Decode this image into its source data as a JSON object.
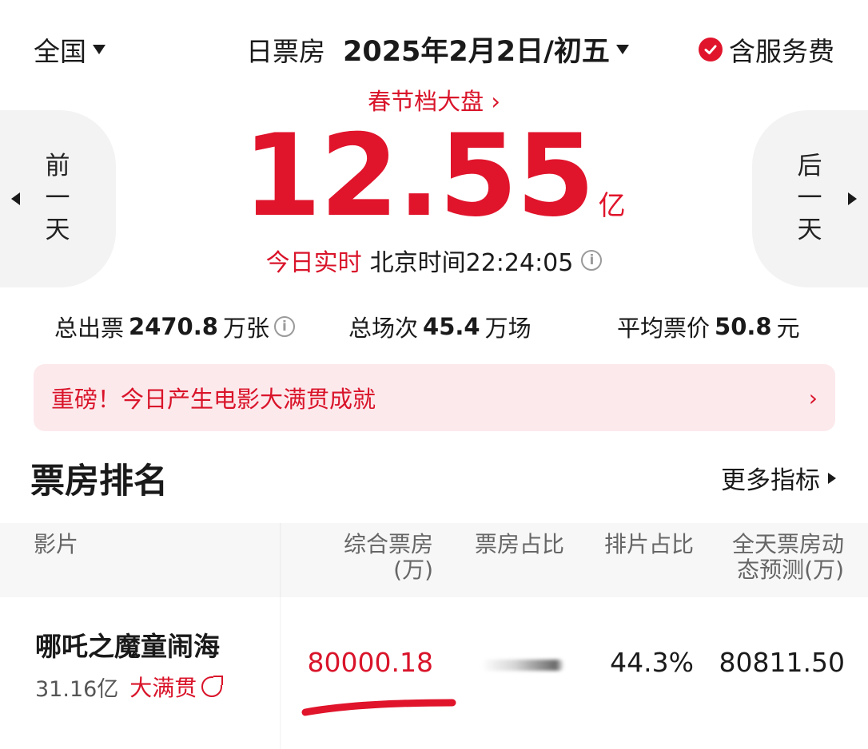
{
  "header": {
    "region": "全国",
    "date_label": "日票房",
    "date_value": "2025年2月2日/初五",
    "service_fee": "含服务费"
  },
  "festival_link": "春节档大盘",
  "box_office": {
    "value": "12.55",
    "unit": "亿"
  },
  "realtime": {
    "label": "今日实时",
    "time": "北京时间22:24:05"
  },
  "nav": {
    "prev": "前一天",
    "next": "后一天"
  },
  "stats": {
    "tickets_label": "总出票",
    "tickets_value": "2470.8",
    "tickets_unit": "万张",
    "shows_label": "总场次",
    "shows_value": "45.4",
    "shows_unit": "万场",
    "price_label": "平均票价",
    "price_value": "50.8",
    "price_unit": "元"
  },
  "banner": {
    "text": "重磅！今日产生电影大满贯成就",
    "chevron": "›"
  },
  "ranking": {
    "title": "票房排名",
    "more": "更多指标"
  },
  "table": {
    "headers": {
      "film": "影片",
      "total_line1": "综合票房",
      "total_line2": "(万)",
      "share": "票房占比",
      "screening": "排片占比",
      "forecast_line1": "全天票房动",
      "forecast_line2": "态预测(万)"
    },
    "rows": [
      {
        "name": "哪吒之魔童闹海",
        "cumulative": "31.16亿",
        "badge": "大满贯",
        "box_office": "80000.18",
        "screening_share": "44.3%",
        "forecast": "80811.50"
      }
    ]
  },
  "colors": {
    "accent": "#e0142b",
    "banner_bg": "#fce9ec",
    "side_bg": "#f3f3f3"
  }
}
